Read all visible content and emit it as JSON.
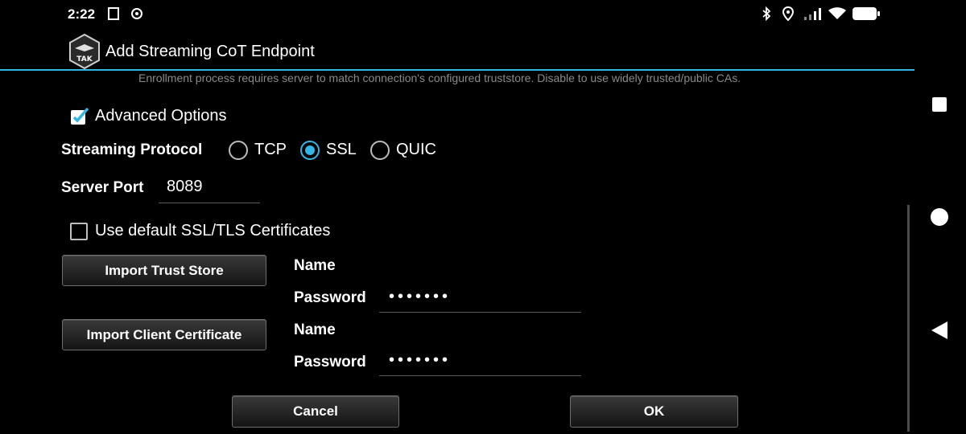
{
  "status_bar": {
    "time": "2:22",
    "icons": [
      "screenshot-icon",
      "sync-icon",
      "bluetooth-icon",
      "location-icon",
      "signal-icon",
      "wifi-icon",
      "battery-icon"
    ]
  },
  "dialog": {
    "title": "Add Streaming CoT Endpoint",
    "logo_text": "TAK",
    "hint": "Enrollment process requires server to match connection's configured truststore. Disable to use widely trusted/public CAs.",
    "advanced_options": {
      "label": "Advanced Options",
      "checked": true
    },
    "streaming_protocol": {
      "label": "Streaming Protocol",
      "options": [
        "TCP",
        "SSL",
        "QUIC"
      ],
      "selected": "SSL"
    },
    "server_port": {
      "label": "Server Port",
      "value": "8089"
    },
    "default_certs": {
      "label": "Use default SSL/TLS Certificates",
      "checked": false
    },
    "trust_store": {
      "button": "Import Trust Store",
      "name_label": "Name",
      "password_label": "Password",
      "password_mask": "•••••••"
    },
    "client_cert": {
      "button": "Import Client Certificate",
      "name_label": "Name",
      "password_label": "Password",
      "password_mask": "•••••••"
    },
    "buttons": {
      "cancel": "Cancel",
      "ok": "OK"
    }
  },
  "colors": {
    "accent": "#33b5e5",
    "background": "#000000"
  }
}
